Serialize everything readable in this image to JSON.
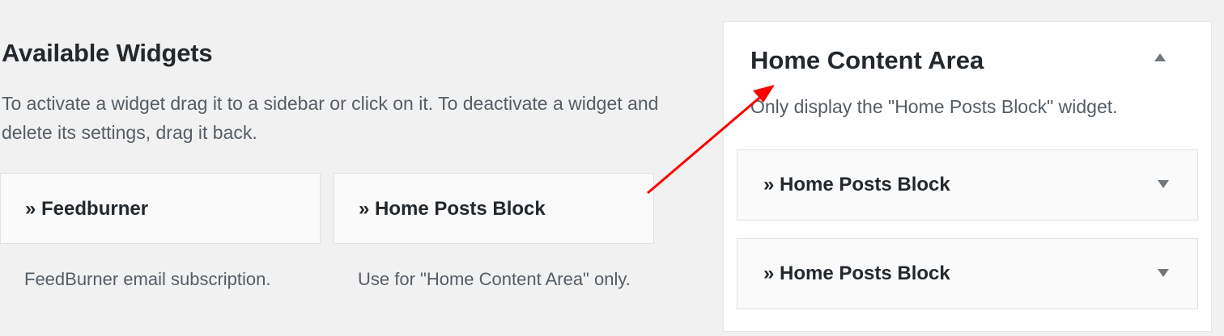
{
  "available_widgets": {
    "title": "Available Widgets",
    "description": "To activate a widget drag it to a sidebar or click on it. To deactivate a widget and delete its settings, drag it back.",
    "widgets": [
      {
        "title": "» Feedburner",
        "description": "FeedBurner email subscription."
      },
      {
        "title": "» Home Posts Block",
        "description": "Use for \"Home Content Area\" only."
      }
    ]
  },
  "sidebar": {
    "title": "Home Content Area",
    "description": "Only display the \"Home Posts Block\" widget.",
    "toggle_icon": "caret-up-icon",
    "widgets": [
      {
        "title": "» Home Posts Block",
        "toggle_icon": "caret-down-icon"
      },
      {
        "title": "» Home Posts Block",
        "toggle_icon": "caret-down-icon"
      }
    ]
  },
  "annotation": {
    "type": "arrow",
    "color": "#ff0000"
  }
}
